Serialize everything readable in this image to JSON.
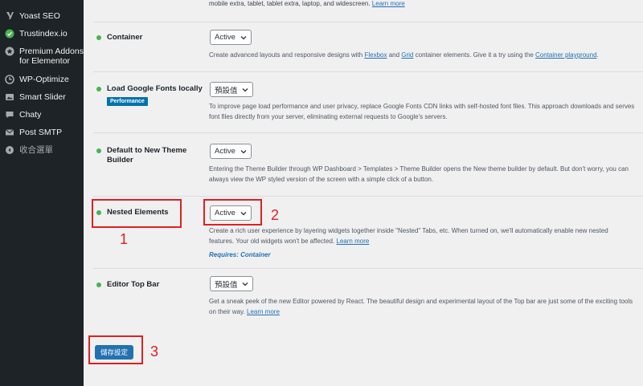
{
  "sidebar": {
    "items": [
      {
        "label": "Yoast SEO",
        "icon": "yoast-icon"
      },
      {
        "label": "Trustindex.io",
        "icon": "checkmark-icon"
      },
      {
        "label": "Premium Addons for Elementor",
        "icon": "premium-addons-icon"
      },
      {
        "label": "WP-Optimize",
        "icon": "optimize-icon"
      },
      {
        "label": "Smart Slider",
        "icon": "slider-icon"
      },
      {
        "label": "Chaty",
        "icon": "chat-icon"
      },
      {
        "label": "Post SMTP",
        "icon": "mail-icon"
      },
      {
        "label": "收合選單",
        "icon": "collapse-icon"
      }
    ]
  },
  "top_note": {
    "text": "mobile extra, tablet, tablet extra, laptop, and widescreen.",
    "link": "Learn more"
  },
  "features": [
    {
      "title": "Container",
      "value": "Active",
      "desc_pre": "Create advanced layouts and responsive designs with ",
      "link1": "Flexbox",
      "desc_and": " and ",
      "link2": "Grid",
      "desc_mid": " container elements. Give it a try using the ",
      "link3": "Container playground",
      "desc_end": "."
    },
    {
      "title": "Load Google Fonts locally",
      "badge": "Performance",
      "value": "預設值",
      "desc": "To improve page load performance and user privacy, replace Google Fonts CDN links with self-hosted font files. This approach downloads and serves font files directly from your server, eliminating external requests to Google's servers."
    },
    {
      "title": "Default to New Theme Builder",
      "value": "Active",
      "desc": "Entering the Theme Builder through WP Dashboard > Templates > Theme Builder opens the New theme builder by default. But don't worry, you can always view the WP styled version of the screen with a simple click of a button."
    },
    {
      "title": "Nested Elements",
      "value": "Active",
      "desc": "Create a rich user experience by layering widgets together inside \"Nested\" Tabs, etc. When turned on, we'll automatically enable new nested features. Your old widgets won't be affected.",
      "link": "Learn more",
      "requires": "Requires: Container"
    },
    {
      "title": "Editor Top Bar",
      "value": "預設值",
      "desc": "Get a sneak peek of the new Editor powered by React. The beautiful design and experimental layout of the Top bar are just some of the exciting tools on their way.",
      "link": "Learn more"
    }
  ],
  "save_button": "儲存設定",
  "annotations": [
    "1",
    "2",
    "3"
  ],
  "colors": {
    "sidebar_bg": "#1d2327",
    "accent": "#2271b1",
    "active_dot": "#46b450",
    "annotation_red": "#e02020"
  }
}
